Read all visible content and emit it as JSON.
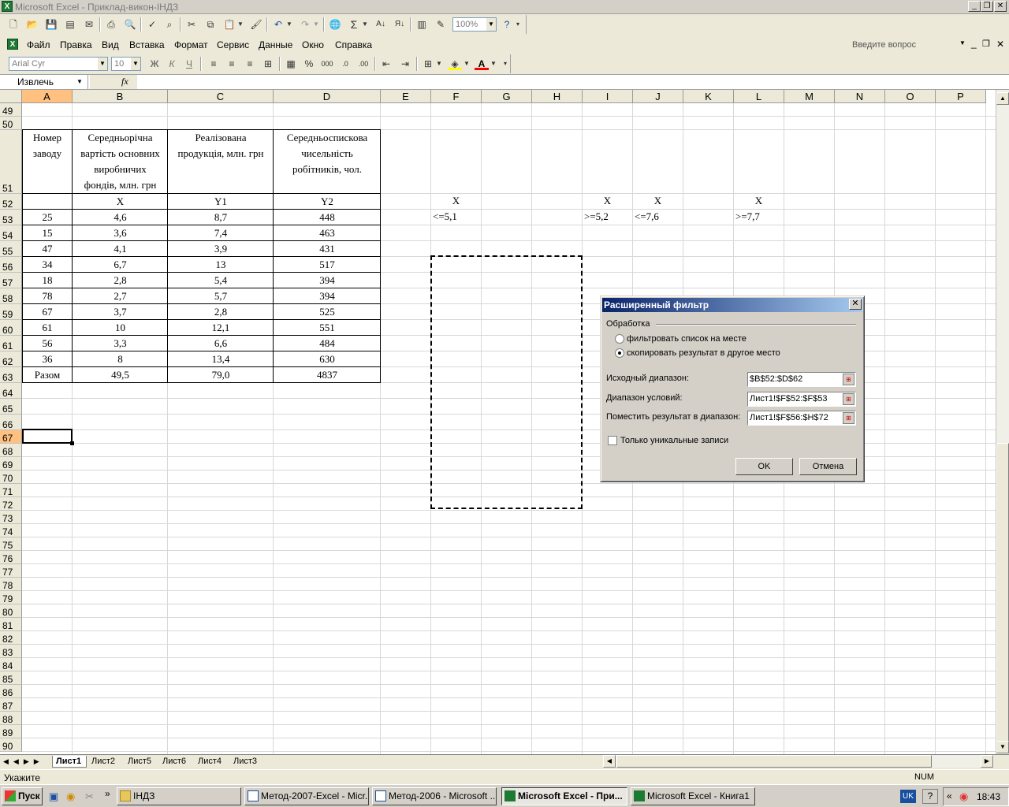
{
  "window": {
    "title": "Microsoft Excel - Приклад-викон-ІНДЗ"
  },
  "menu": [
    "Файл",
    "Правка",
    "Вид",
    "Вставка",
    "Формат",
    "Сервис",
    "Данные",
    "Окно",
    "Справка"
  ],
  "help_box": {
    "placeholder": "Введите вопрос"
  },
  "toolbar": {
    "zoom": "100%"
  },
  "format_toolbar": {
    "font": "Arial Cyr",
    "size": "10",
    "bold": "Ж",
    "italic": "К",
    "underline": "Ч"
  },
  "formula_bar": {
    "name_box": "Извлечь",
    "fx": "fx"
  },
  "columns": [
    "A",
    "B",
    "C",
    "D",
    "E",
    "F",
    "G",
    "H",
    "I",
    "J",
    "K",
    "L",
    "M",
    "N",
    "O",
    "P"
  ],
  "rows": [
    "49",
    "50",
    "51",
    "52",
    "53",
    "54",
    "55",
    "56",
    "57",
    "58",
    "59",
    "60",
    "61",
    "62",
    "63",
    "64",
    "65",
    "66",
    "67",
    "68",
    "69",
    "70",
    "71",
    "72",
    "73",
    "74",
    "75",
    "76",
    "77",
    "78",
    "79",
    "80",
    "81",
    "82",
    "83",
    "84",
    "85",
    "86",
    "87",
    "88",
    "89",
    "90"
  ],
  "table": {
    "headers": [
      "Номер заводу",
      "Середньорічна вартість основних виробничих фондів, млн. грн",
      "Реалізована продукція, млн. грн",
      "Середньоспискова чисельність робітників, чол."
    ],
    "header_lines": [
      [
        "Номер",
        "заводу"
      ],
      [
        "Середньорічна",
        "вартість основних",
        "виробничих",
        "фондів, млн. грн"
      ],
      [
        "Реалізована",
        "продукція, млн. грн"
      ],
      [
        "Середньоспискова",
        "чисельність",
        "робітників, чол."
      ]
    ],
    "labels": [
      "",
      "X",
      "Y1",
      "Y2"
    ],
    "rows": [
      [
        "25",
        "4,6",
        "8,7",
        "448"
      ],
      [
        "15",
        "3,6",
        "7,4",
        "463"
      ],
      [
        "47",
        "4,1",
        "3,9",
        "431"
      ],
      [
        "34",
        "6,7",
        "13",
        "517"
      ],
      [
        "18",
        "2,8",
        "5,4",
        "394"
      ],
      [
        "78",
        "2,7",
        "5,7",
        "394"
      ],
      [
        "67",
        "3,7",
        "2,8",
        "525"
      ],
      [
        "61",
        "10",
        "12,1",
        "551"
      ],
      [
        "56",
        "3,3",
        "6,6",
        "484"
      ],
      [
        "36",
        "8",
        "13,4",
        "630"
      ]
    ],
    "total": [
      "Разом",
      "49,5",
      "79,0",
      "4837"
    ]
  },
  "criteria": {
    "F52": "X",
    "F53": "<=5,1",
    "I52": "X",
    "I53": ">=5,2",
    "J52": "X",
    "J53": "<=7,6",
    "L52": "X",
    "L53": ">=7,7"
  },
  "sheet_tabs": [
    "Лист1",
    "Лист2",
    "Лист5",
    "Лист6",
    "Лист4",
    "Лист3"
  ],
  "status": {
    "mode": "Укажите",
    "num": "NUM"
  },
  "dialog": {
    "title": "Расширенный фильтр",
    "group_label": "Обработка",
    "option_inplace": "фильтровать список на месте",
    "option_copy": "скопировать результат в другое место",
    "list_range_label": "Исходный диапазон:",
    "list_range_value": "$B$52:$D$62",
    "criteria_range_label": "Диапазон условий:",
    "criteria_range_value": "Лист1!$F$52:$F$53",
    "copy_to_label": "Поместить результат в диапазон:",
    "copy_to_value": "Лист1!$F$56:$H$72",
    "unique_label": "Только уникальные записи",
    "ok": "OK",
    "cancel": "Отмена"
  },
  "taskbar": {
    "start": "Пуск",
    "items": [
      "ІНДЗ",
      "Метод-2007-Excel - Micr...",
      "Метод-2006 - Microsoft ...",
      "Microsoft Excel - При...",
      "Microsoft Excel - Книга1"
    ],
    "lang": "UK",
    "clock": "18:43"
  }
}
